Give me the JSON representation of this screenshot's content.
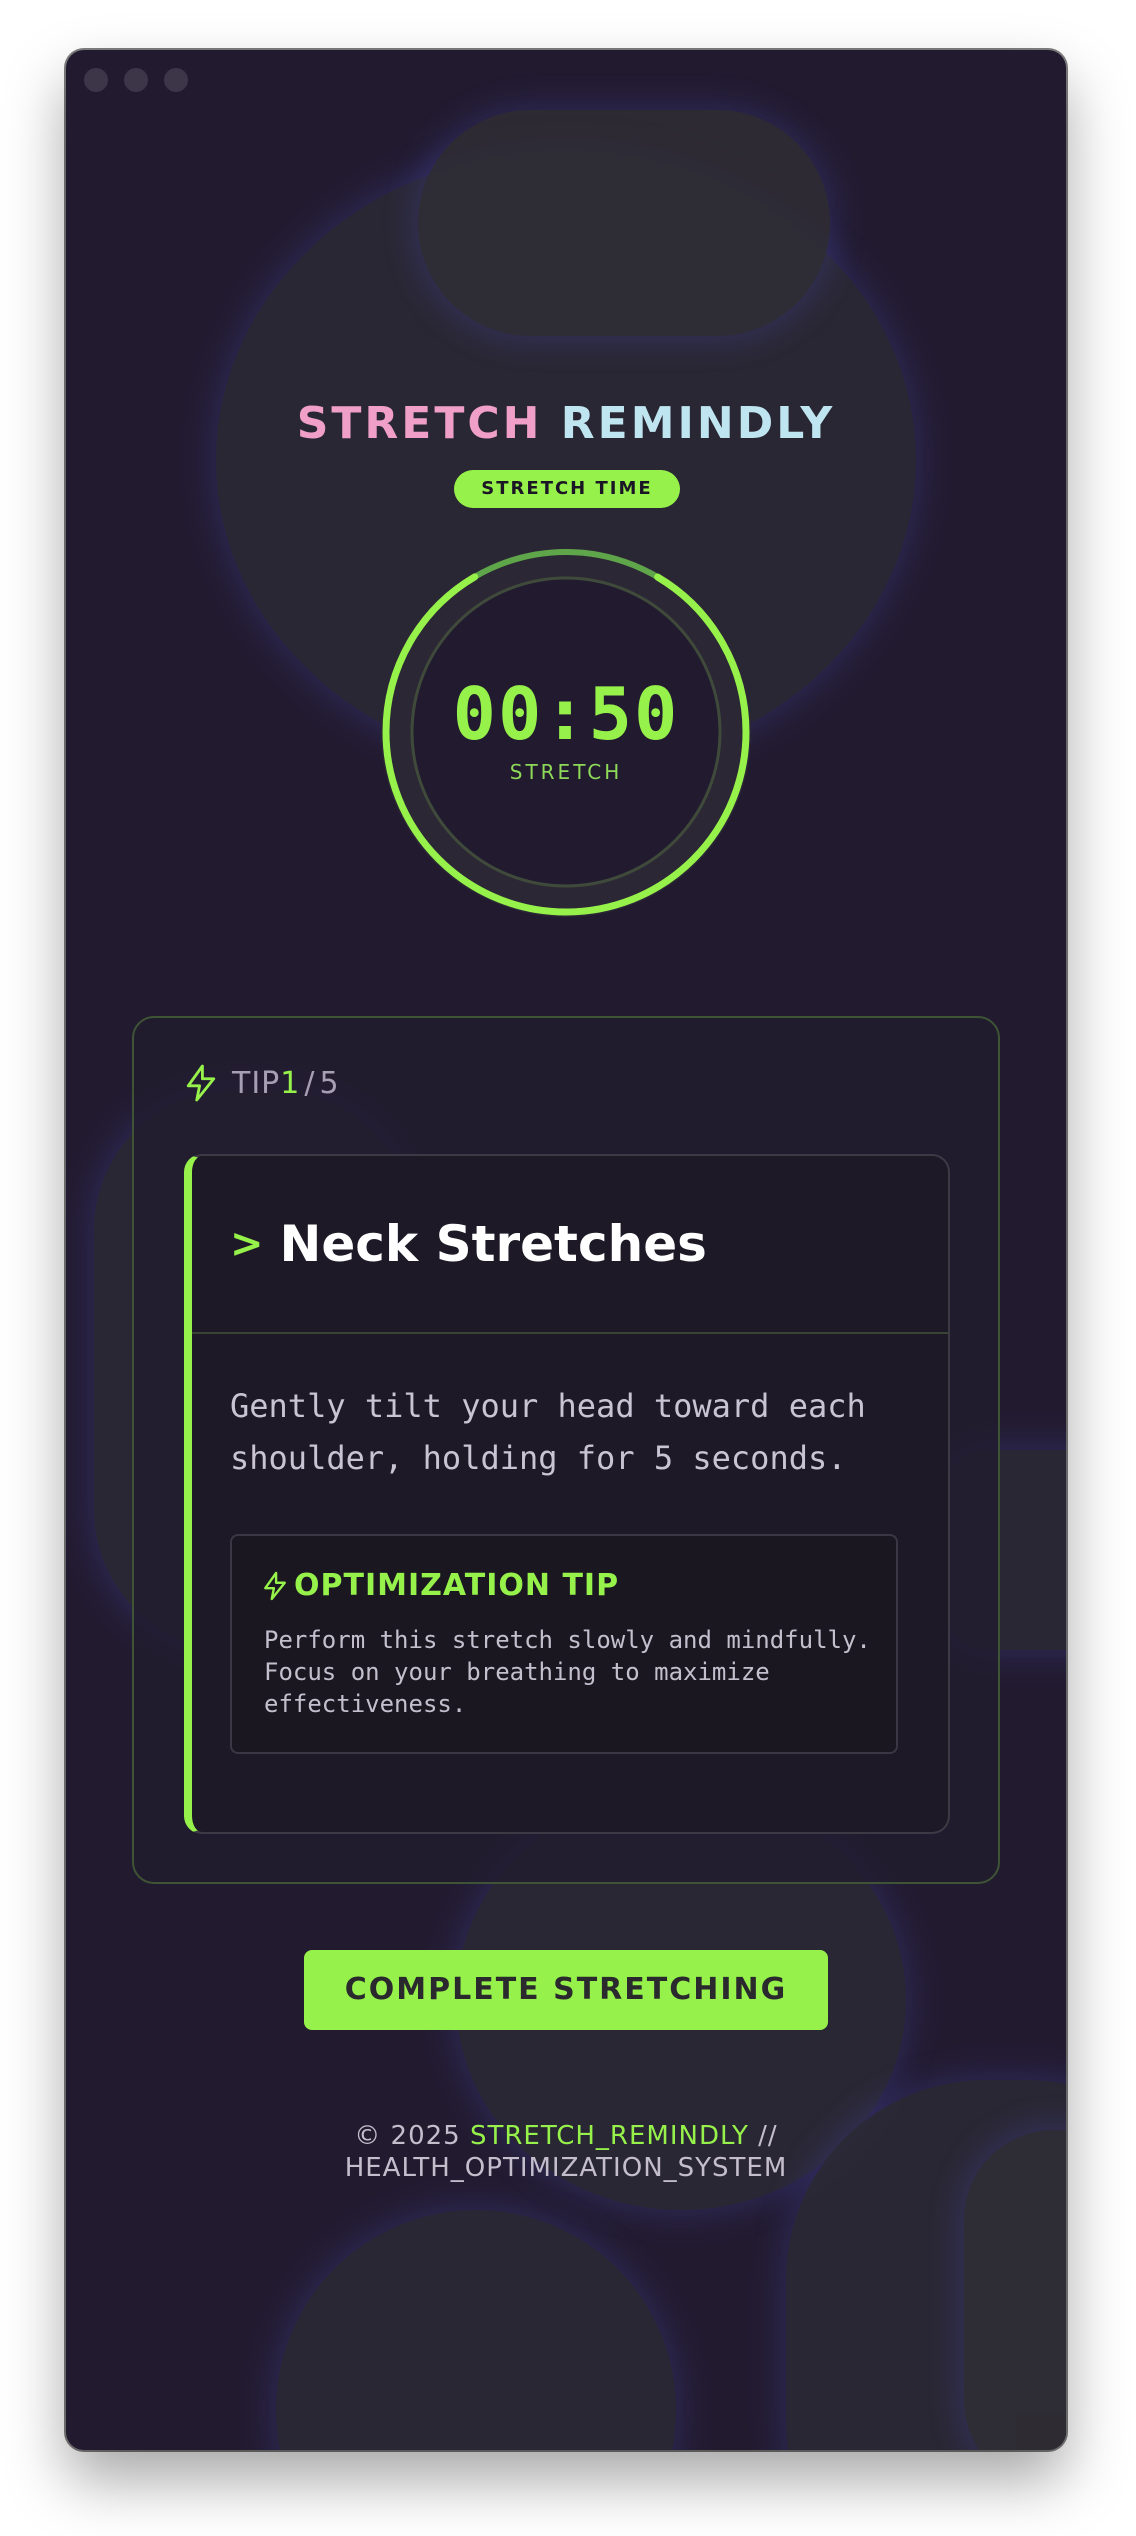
{
  "app": {
    "title_part1": "STRETCH",
    "title_part2": "REMINDLY",
    "mode_badge": "STRETCH TIME"
  },
  "timer": {
    "display": "00:50",
    "label": "STRETCH",
    "progress": 0.83
  },
  "tip": {
    "prefix": "TIP",
    "current": "1",
    "separator": "/",
    "total": "5",
    "title": "Neck Stretches",
    "description": "Gently tilt your head toward each shoulder, holding for 5 seconds.",
    "optimization_heading": "OPTIMIZATION TIP",
    "optimization_text": "Perform this stretch slowly and mindfully. Focus on your breathing to maximize effectiveness."
  },
  "actions": {
    "complete_label": "COMPLETE STRETCHING"
  },
  "footer": {
    "copyright": "© 2025",
    "brand": "STRETCH_REMINDLY",
    "suffix": "//",
    "line2": "HEALTH_OPTIMIZATION_SYSTEM"
  },
  "colors": {
    "accent": "#96f24a",
    "background": "#221b30",
    "title_pink": "#f0a0c8",
    "title_cyan": "#bfe6f0"
  },
  "icons": {
    "tip_icon": "lightning-bolt-icon",
    "title_chevron": "chevron-right-icon",
    "optimization_icon": "lightning-bolt-icon"
  }
}
